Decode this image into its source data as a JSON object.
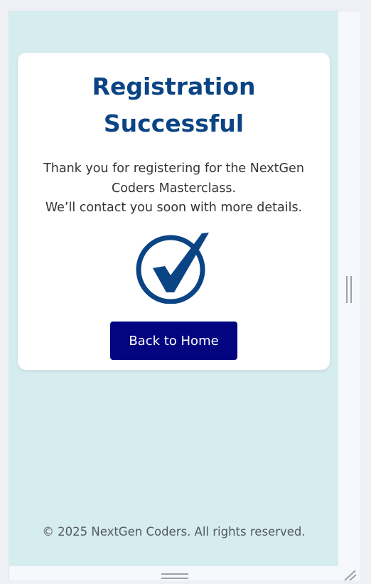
{
  "card": {
    "title": "Registration Successful",
    "message_line1": "Thank you for registering for the NextGen Coders Masterclass.",
    "message_line2": "We’ll contact you soon with more details.",
    "check_icon": "check-circle-icon",
    "button_label": "Back to Home"
  },
  "footer": {
    "text": "© 2025 NextGen Coders. All rights reserved."
  },
  "colors": {
    "background": "#d6edf0",
    "title": "#0b4484",
    "button": "#02057f",
    "icon": "#0b4484"
  }
}
